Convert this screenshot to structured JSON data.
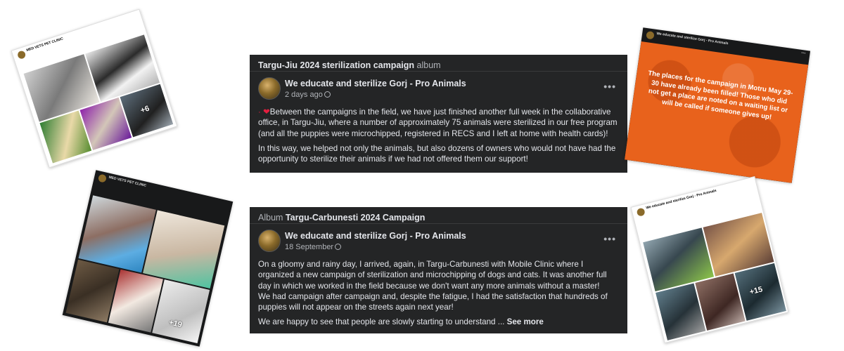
{
  "page": {
    "name": "We educate and sterilize Gorj - Pro Animals"
  },
  "top_card": {
    "album_title": "Targu-Jiu 2024 sterilization campaign",
    "album_suffix": "album",
    "time": "2 days ago",
    "paragraph1": "Between the campaigns in the field, we have just finished another full week in the collaborative office, in Targu-Jiu, where a number of approximately 75 animals were sterilized in our free program (and all the puppies were microchipped, registered in RECS and I left at home with health cards)!",
    "paragraph2": "In this way, we helped not only the animals, but also dozens of owners who would not have had the opportunity to sterilize their animals if we had not offered them our support!"
  },
  "bottom_card": {
    "album_prefix": "Album",
    "album_title": "Targu-Carbunesti 2024 Campaign",
    "time": "18 September",
    "paragraph1": "On a gloomy and rainy day, I arrived, again, in Targu-Carbunesti with Mobile Clinic where I organized a new campaign of sterilization and microchipping of dogs and cats. It was another full day in which we worked in the field because we don't want any more animals without a master!",
    "paragraph2": "We had campaign after campaign and, despite the fatigue, I had the satisfaction that hundreds of puppies will not appear on the streets again next year!",
    "paragraph3": "We are happy to see that people are slowly starting to understand ...",
    "see_more": "See more"
  },
  "thumbnails": {
    "top_left": {
      "page_name": "MED VETS PET CLINIC",
      "plus_count": "+6"
    },
    "top_right": {
      "page_name": "We educate and sterilize Gorj - Pro Animals",
      "text": "The places for the campaign in Motru May 29-30 have already been filled! Those who did not get a place are noted on a waiting list or will be called if someone gives up!"
    },
    "bottom_left": {
      "page_name": "MED VETS PET CLINIC",
      "plus_count": "+19"
    },
    "bottom_right": {
      "page_name": "We educate and sterilize Gorj - Pro Animals",
      "plus_count": "+15"
    }
  },
  "colors": {
    "card_bg": "#242526",
    "orange": "#e8621c",
    "heart": "#e41e3f"
  },
  "icons": [
    "heart-icon",
    "globe-icon",
    "more-options-icon"
  ]
}
